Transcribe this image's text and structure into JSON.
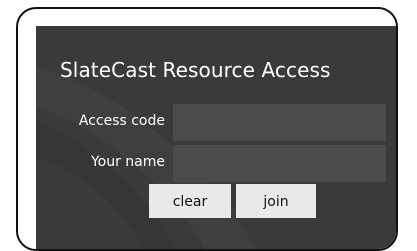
{
  "form": {
    "title": "SlateCast Resource Access",
    "access_code_label": "Access code",
    "access_code_value": "",
    "your_name_label": "Your name",
    "your_name_value": "",
    "clear_label": "clear",
    "join_label": "join"
  },
  "colors": {
    "panel_background": "#3a3a3a",
    "input_background": "#4b4b4b",
    "button_background": "#e9e9e9",
    "text_on_dark": "#ffffff"
  }
}
